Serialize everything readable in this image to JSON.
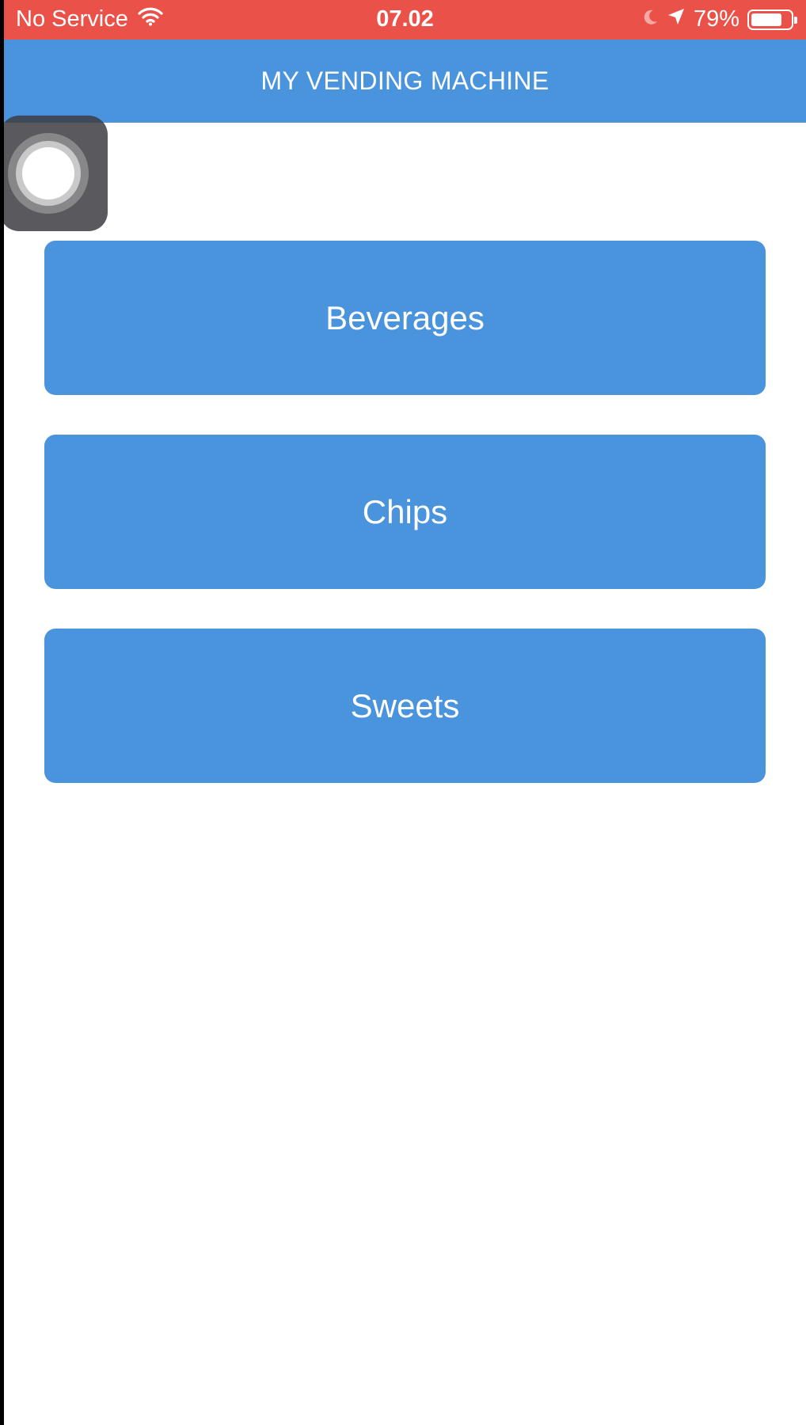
{
  "status_bar": {
    "carrier": "No Service",
    "wifi_icon": "wifi-icon",
    "time": "07.02",
    "moon_icon": "moon-icon",
    "location_icon": "location-arrow-icon",
    "battery_percent": "79%",
    "battery_level": 0.79,
    "background_color": "#ea5148"
  },
  "nav_bar": {
    "title": "MY VENDING MACHINE",
    "background_color": "#4a93dd"
  },
  "menu": {
    "items": [
      {
        "label": "Beverages"
      },
      {
        "label": "Chips"
      },
      {
        "label": "Sweets"
      }
    ],
    "button_color": "#4a93dd"
  },
  "assistive_touch": {
    "icon": "assistive-touch-icon"
  }
}
